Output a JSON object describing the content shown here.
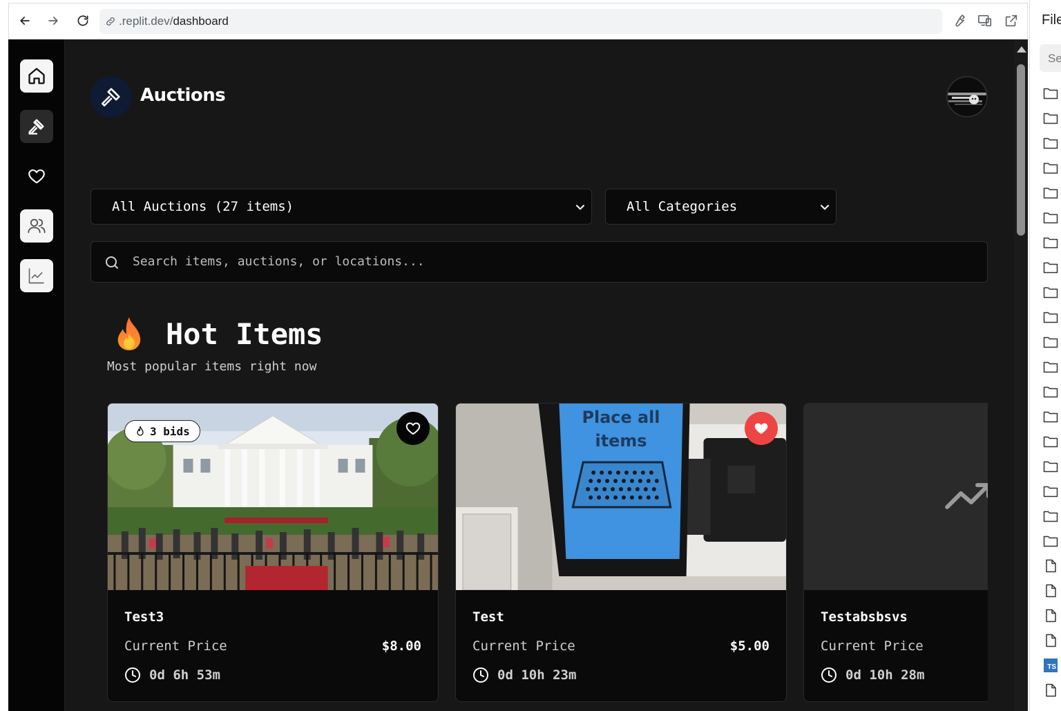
{
  "browser": {
    "url_prefix": ".replit.dev/",
    "url_path": "dashboard"
  },
  "header": {
    "title": "Auctions"
  },
  "sidebar": {
    "items": [
      {
        "icon": "home-icon"
      },
      {
        "icon": "gavel-icon"
      },
      {
        "icon": "heart-icon"
      },
      {
        "icon": "users-icon"
      },
      {
        "icon": "chart-icon"
      }
    ]
  },
  "filters": {
    "auctions_select": "All Auctions (27 items)",
    "categories_select": "All Categories"
  },
  "search": {
    "placeholder": "Search items, auctions, or locations..."
  },
  "hot": {
    "title": "Hot Items",
    "subtitle": "Most popular items right now"
  },
  "cards": [
    {
      "name": "Test3",
      "price_label": "Current Price",
      "price": "$8.00",
      "time": "0d 6h 53m",
      "bids": "3 bids",
      "favorited": false
    },
    {
      "name": "Test",
      "price_label": "Current Price",
      "price": "$5.00",
      "time": "0d 10h 23m",
      "favorited": true,
      "image_text_1": "Place all",
      "image_text_2": "items"
    },
    {
      "name": "Testabsbsvs",
      "price_label": "Current Price",
      "time": "0d 10h 28m"
    }
  ],
  "file_panel": {
    "title": "Files",
    "search_placeholder": "Se",
    "ts_label": "TS"
  },
  "colors": {
    "app_bg": "#171717",
    "card_bg": "#0a0a0a",
    "favorite_active": "#ef4444",
    "logo_bg": "#0f1a33"
  }
}
